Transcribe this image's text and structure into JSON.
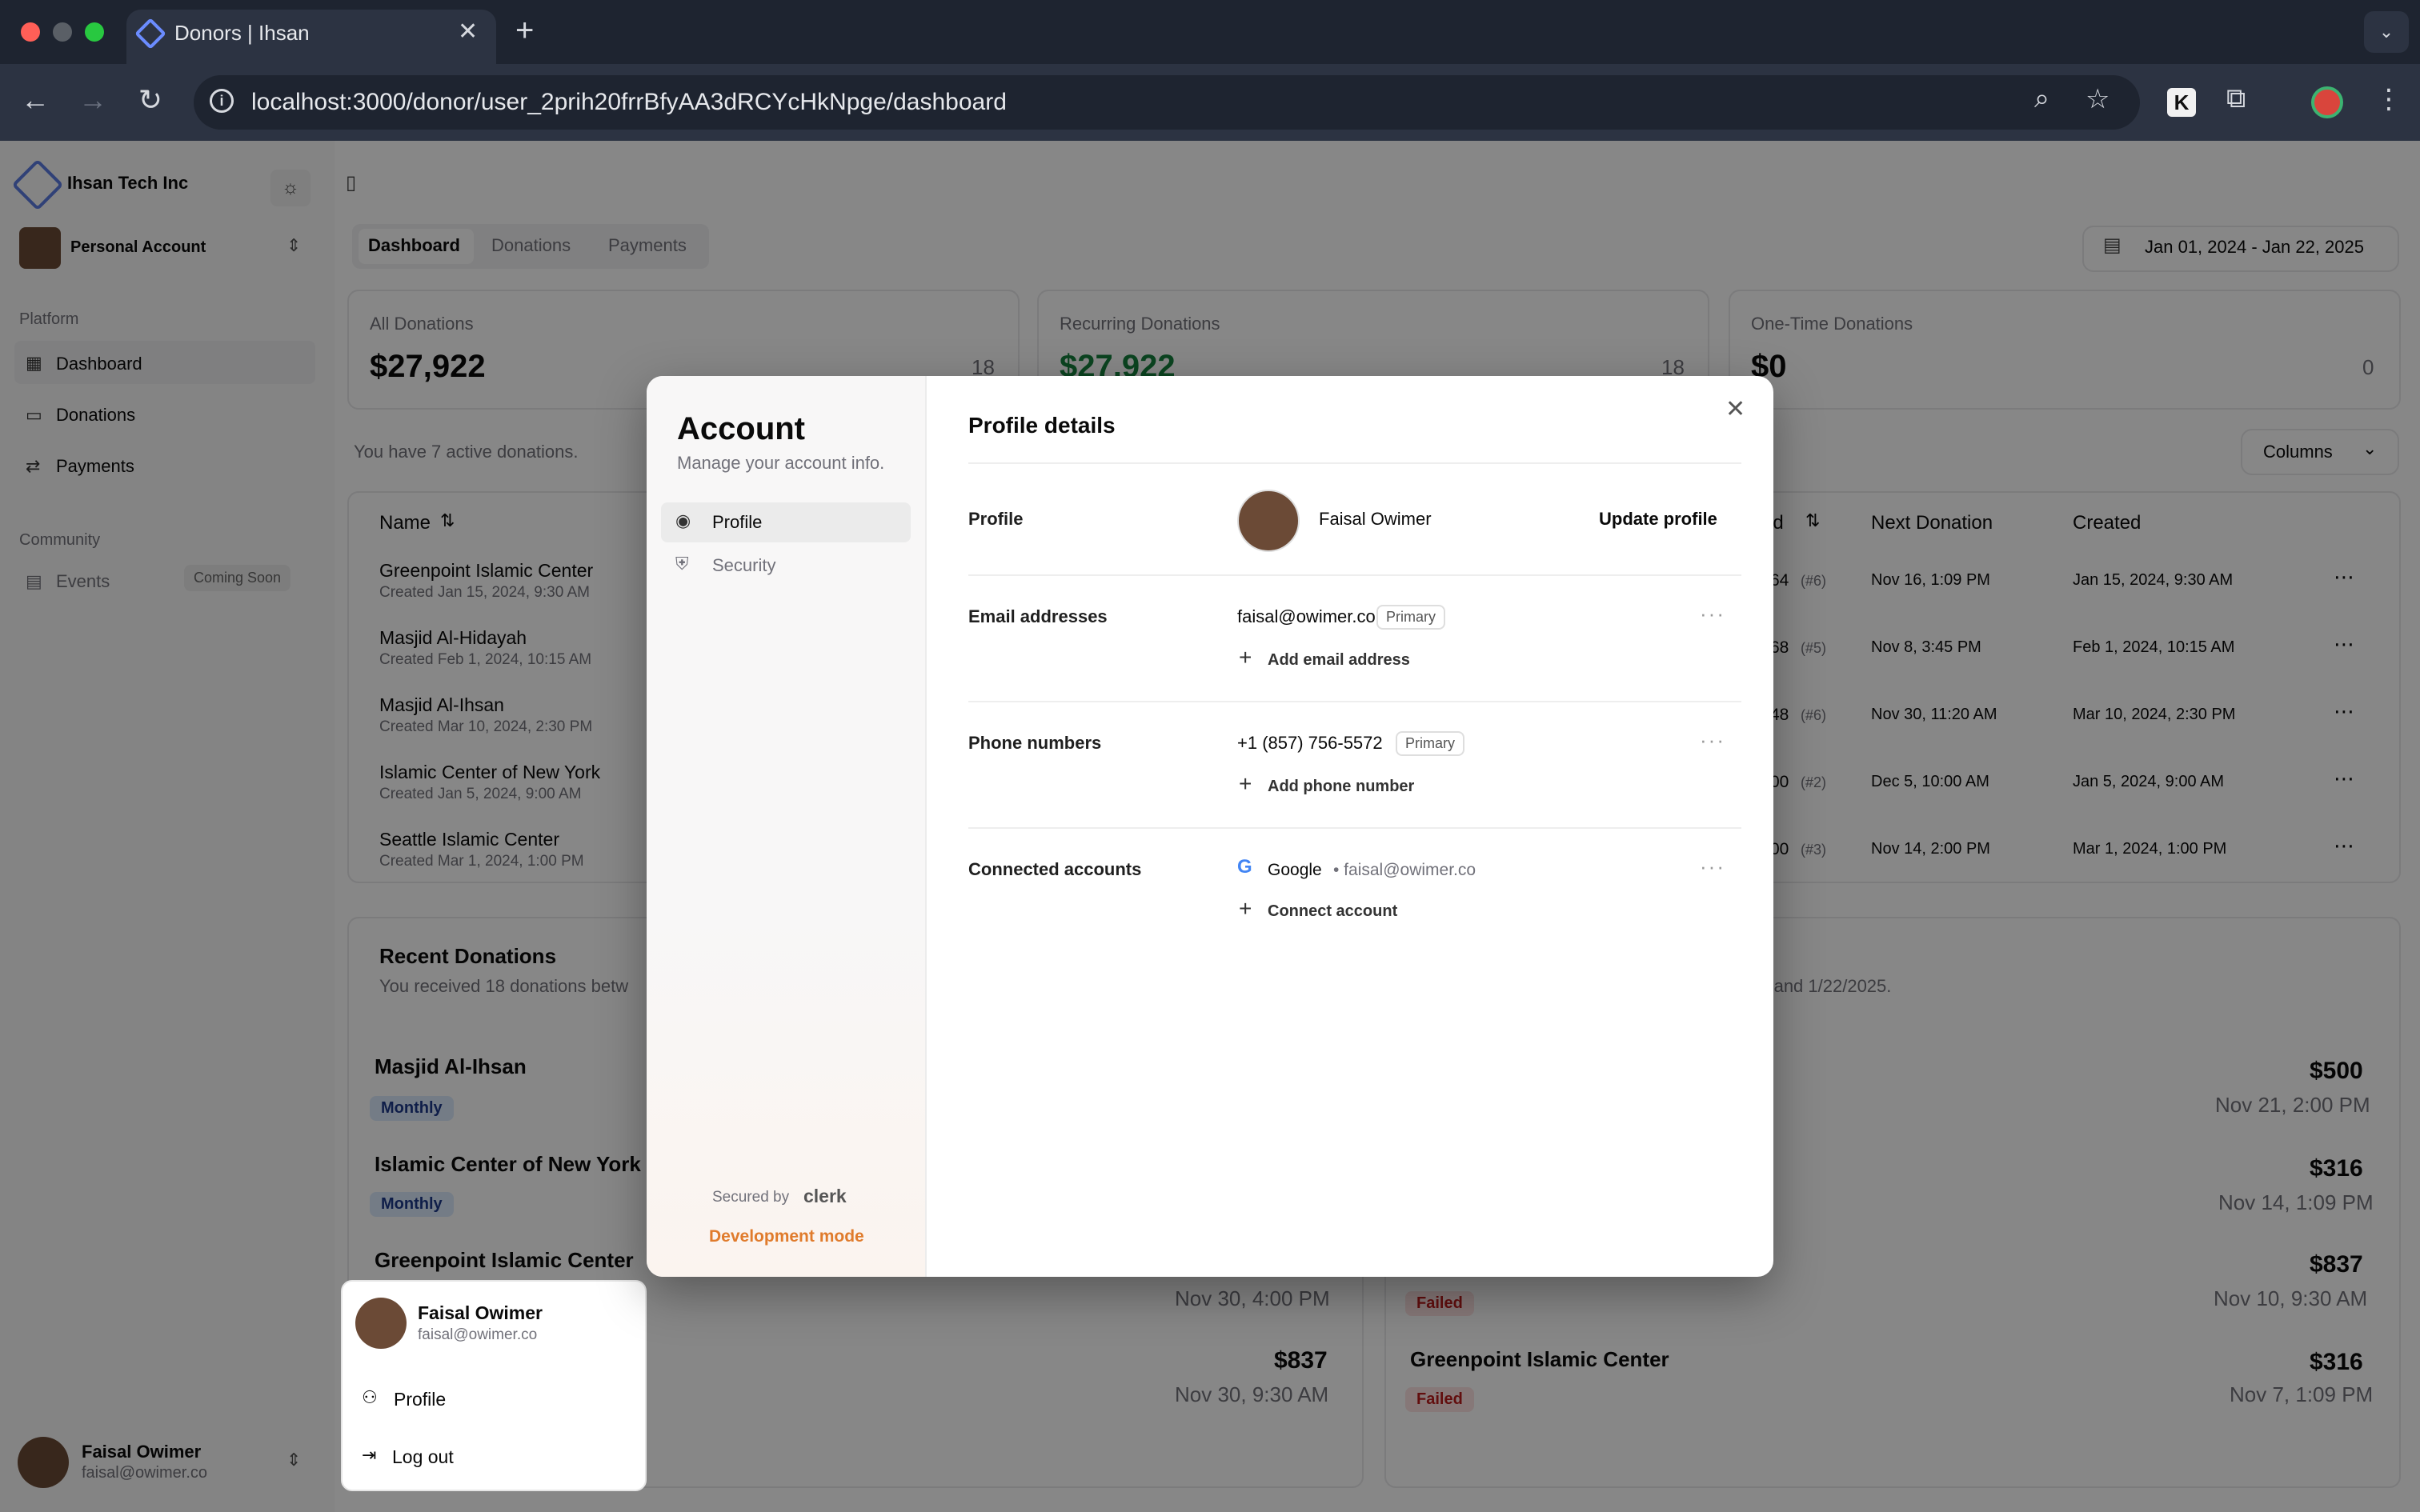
{
  "browser": {
    "tab_title": "Donors | Ihsan",
    "url": "localhost:3000/donor/user_2prih20frrBfyAA3dRCYcHkNpge/dashboard"
  },
  "sidebar": {
    "org_name": "Ihsan Tech Inc",
    "account_switcher": "Personal Account",
    "platform_heading": "Platform",
    "nav": [
      {
        "label": "Dashboard"
      },
      {
        "label": "Donations"
      },
      {
        "label": "Payments"
      }
    ],
    "community_heading": "Community",
    "events_label": "Events",
    "events_badge": "Coming Soon",
    "user": {
      "name": "Faisal Owimer",
      "email": "faisal@owimer.co"
    }
  },
  "header": {
    "tabs": [
      {
        "label": "Dashboard"
      },
      {
        "label": "Donations"
      },
      {
        "label": "Payments"
      }
    ],
    "date_range": "Jan 01, 2024 - Jan 22, 2025"
  },
  "stats": [
    {
      "title": "All Donations",
      "value": "$27,922",
      "count": "18"
    },
    {
      "title": "Recurring Donations",
      "value": "$27,922",
      "count": "18"
    },
    {
      "title": "One-Time Donations",
      "value": "$0",
      "count": "0"
    }
  ],
  "table": {
    "summary": "You have 7 active donations.",
    "columns_button": "Columns",
    "headers": {
      "name": "Name",
      "spend_partial": "nd",
      "next": "Next Donation",
      "created": "Created"
    },
    "rows": [
      {
        "name": "Greenpoint Islamic Center",
        "sub": "Created Jan 15, 2024, 9:30 AM",
        "amount_partial": "64",
        "count": "(#6)",
        "next": "Nov 16, 1:09 PM",
        "created": "Jan 15, 2024, 9:30 AM"
      },
      {
        "name": "Masjid Al-Hidayah",
        "sub": "Created Feb 1, 2024, 10:15 AM",
        "amount_partial": "68",
        "count": "(#5)",
        "next": "Nov 8, 3:45 PM",
        "created": "Feb 1, 2024, 10:15 AM"
      },
      {
        "name": "Masjid Al-Ihsan",
        "sub": "Created Mar 10, 2024, 2:30 PM",
        "amount_partial": "48",
        "count": "(#6)",
        "next": "Nov 30, 11:20 AM",
        "created": "Mar 10, 2024, 2:30 PM"
      },
      {
        "name": "Islamic Center of New York",
        "sub": "Created Jan 5, 2024, 9:00 AM",
        "amount_partial": "00",
        "count": "(#2)",
        "next": "Dec 5, 10:00 AM",
        "created": "Jan 5, 2024, 9:00 AM"
      },
      {
        "name": "Seattle Islamic Center",
        "sub": "Created Mar 1, 2024, 1:00 PM",
        "amount_partial": "00",
        "count": "(#3)",
        "next": "Nov 14, 2:00 PM",
        "created": "Mar 1, 2024, 1:00 PM"
      }
    ]
  },
  "recent": {
    "title": "Recent Donations",
    "subtitle_left": "You received 18 donations betw",
    "subtitle_right": "24 and 1/22/2025.",
    "left_items": [
      {
        "name": "Masjid Al-Ihsan",
        "badge": "Monthly"
      },
      {
        "name": "Islamic Center of New York",
        "badge": "Monthly"
      },
      {
        "name": "Greenpoint Islamic Center"
      }
    ],
    "left_amounts": [
      {
        "date": "Nov 30, 4:00 PM"
      },
      {
        "amount": "$837",
        "date": "Nov 30, 9:30 AM"
      }
    ],
    "right_items": [
      {
        "amount": "$500",
        "date": "Nov 21, 2:00 PM"
      },
      {
        "amount": "$316",
        "date": "Nov 14, 1:09 PM"
      },
      {
        "amount": "$837",
        "date": "Nov 10, 9:30 AM",
        "badge": "Failed"
      },
      {
        "name": "Greenpoint Islamic Center",
        "amount": "$316",
        "date": "Nov 7, 1:09 PM",
        "badge": "Failed"
      }
    ]
  },
  "user_menu": {
    "name": "Faisal Owimer",
    "email": "faisal@owimer.co",
    "profile": "Profile",
    "logout": "Log out"
  },
  "modal": {
    "title": "Account",
    "subtitle": "Manage your account info.",
    "nav": [
      {
        "label": "Profile"
      },
      {
        "label": "Security"
      }
    ],
    "secured_by": "Secured by",
    "clerk": "clerk",
    "dev_mode": "Development mode",
    "heading": "Profile details",
    "profile_label": "Profile",
    "profile_name": "Faisal Owimer",
    "update_profile": "Update profile",
    "email_label": "Email addresses",
    "email": "faisal@owimer.co",
    "primary": "Primary",
    "add_email": "Add email address",
    "phone_label": "Phone numbers",
    "phone": "+1 (857) 756-5572",
    "add_phone": "Add phone number",
    "connected_label": "Connected accounts",
    "google": "Google",
    "google_email": "• faisal@owimer.co",
    "connect_account": "Connect account"
  },
  "colors": {
    "accent_green": "#15803d",
    "monthly_bg": "#dbeafe",
    "failed_bg": "#fee2e2",
    "dev_orange": "#e07b2c"
  }
}
